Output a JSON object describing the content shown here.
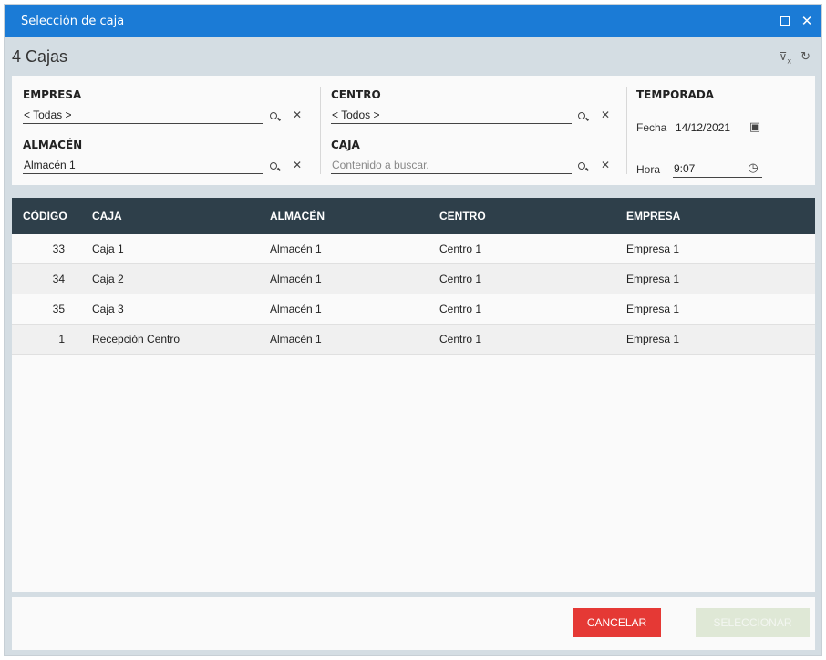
{
  "window": {
    "title": "Selección de caja"
  },
  "header": {
    "count_title": "4 Cajas",
    "clear_filters_icon": "filter-clear-icon",
    "refresh_icon": "refresh-icon"
  },
  "filters": {
    "empresa": {
      "label": "EMPRESA",
      "value": "< Todas >"
    },
    "almacen": {
      "label": "ALMACÉN",
      "value": "Almacén 1"
    },
    "centro": {
      "label": "CENTRO",
      "value": "< Todos >"
    },
    "caja": {
      "label": "CAJA",
      "placeholder": "Contenido a buscar."
    },
    "temporada": {
      "label": "TEMPORADA",
      "fecha_label": "Fecha",
      "fecha_value": "14/12/2021",
      "hora_label": "Hora",
      "hora_value": "9:07"
    }
  },
  "grid": {
    "columns": [
      "CÓDIGO",
      "CAJA",
      "ALMACÉN",
      "CENTRO",
      "EMPRESA"
    ],
    "rows": [
      {
        "codigo": "33",
        "caja": "Caja 1",
        "almacen": "Almacén 1",
        "centro": "Centro 1",
        "empresa": "Empresa 1"
      },
      {
        "codigo": "34",
        "caja": "Caja 2",
        "almacen": "Almacén 1",
        "centro": "Centro 1",
        "empresa": "Empresa 1"
      },
      {
        "codigo": "35",
        "caja": "Caja 3",
        "almacen": "Almacén 1",
        "centro": "Centro 1",
        "empresa": "Empresa 1"
      },
      {
        "codigo": "1",
        "caja": "Recepción Centro",
        "almacen": "Almacén 1",
        "centro": "Centro 1",
        "empresa": "Empresa 1"
      }
    ]
  },
  "footer": {
    "cancel_label": "CANCELAR",
    "select_label": "SELECCIONAR"
  },
  "colors": {
    "titlebar": "#1b7bd6",
    "grid_header": "#2e3f4a",
    "cancel": "#e53935",
    "select_disabled": "#dfe8d6"
  }
}
